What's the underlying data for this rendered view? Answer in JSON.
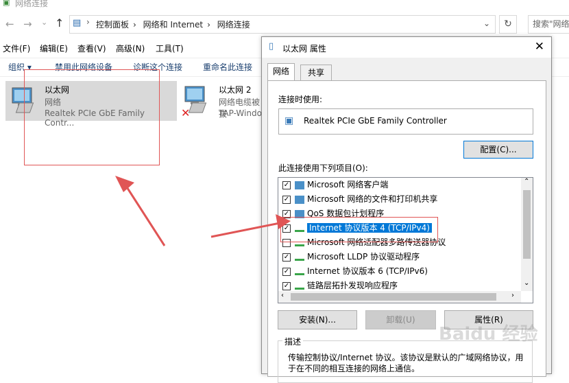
{
  "window": {
    "title": "网络连接"
  },
  "breadcrumb": [
    "控制面板",
    "网络和 Internet",
    "网络连接"
  ],
  "search": {
    "placeholder": "搜索\"网络"
  },
  "menu": [
    "文件(F)",
    "编辑(E)",
    "查看(V)",
    "高级(N)",
    "工具(T)"
  ],
  "commands": [
    "组织 ▾",
    "禁用此网络设备",
    "诊断这个连接",
    "重命名此连接"
  ],
  "adapters": [
    {
      "name": "以太网",
      "status": "网络",
      "device": "Realtek PCIe GbE Family Contr..."
    },
    {
      "name": "以太网 2",
      "status": "网络电缆被拔",
      "device": "TAP-Windo"
    }
  ],
  "dialog": {
    "title": "以太网 属性",
    "tabs": [
      "网络",
      "共享"
    ],
    "connect_using_label": "连接时使用:",
    "adapter_name": "Realtek PCIe GbE Family Controller",
    "configure_button": "配置(C)...",
    "items_label": "此连接使用下列项目(O):",
    "items": [
      {
        "label": "Microsoft 网络客户端",
        "checked": true
      },
      {
        "label": "Microsoft 网络的文件和打印机共享",
        "checked": true
      },
      {
        "label": "QoS 数据包计划程序",
        "checked": true
      },
      {
        "label": "Internet 协议版本 4 (TCP/IPv4)",
        "checked": true,
        "selected": true
      },
      {
        "label": "Microsoft 网络适配器多路传送器协议",
        "checked": false
      },
      {
        "label": "Microsoft LLDP 协议驱动程序",
        "checked": true
      },
      {
        "label": "Internet 协议版本 6 (TCP/IPv6)",
        "checked": true
      },
      {
        "label": "链路层拓扑发现响应程序",
        "checked": true
      }
    ],
    "install_button": "安装(N)...",
    "uninstall_button": "卸载(U)",
    "properties_button": "属性(R)",
    "description_label": "描述",
    "description_text": "传输控制协议/Internet 协议。该协议是默认的广域网络协议，用",
    "description_text2": "于在不同的相互连接的网络上通信。"
  },
  "watermark": "Baidu 经验",
  "colors": {
    "accent": "#0078d7",
    "annotation": "#e05555"
  }
}
